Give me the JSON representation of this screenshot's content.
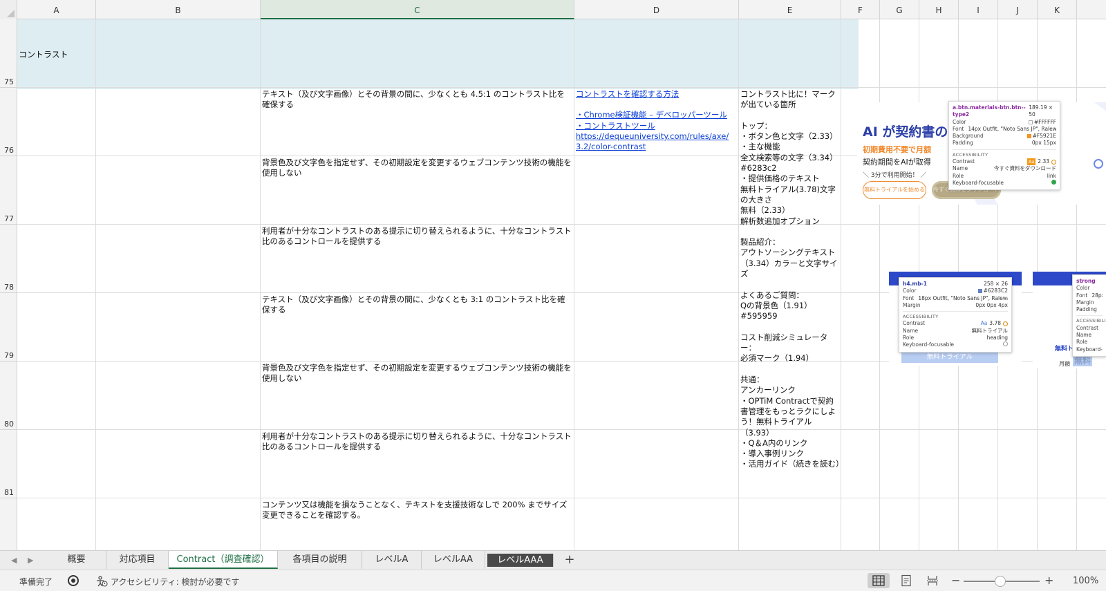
{
  "columns": [
    "A",
    "B",
    "C",
    "D",
    "E",
    "F",
    "G",
    "H",
    "I",
    "J",
    "K"
  ],
  "selected_column": "C",
  "rows": [
    "75",
    "76",
    "77",
    "78",
    "79",
    "80",
    "81"
  ],
  "section_title": "コントラスト",
  "c_cells": [
    "テキスト（及び文字画像）とその背景の間に、少なくとも 4.5:1 のコントラスト比を確保する",
    "背景色及び文字色を指定せず、その初期設定を変更するウェブコンテンツ技術の機能を使用しない",
    "利用者が十分なコントラストのある提示に切り替えられるように、十分なコントラスト比のあるコントロールを提供する",
    "テキスト（及び文字画像）とその背景の間に、少なくとも 3:1 のコントラスト比を確保する",
    "背景色及び文字色を指定せず、その初期設定を変更するウェブコンテンツ技術の機能を使用しない",
    "利用者が十分なコントラストのある提示に切り替えられるように、十分なコントラスト比のあるコントロールを提供する",
    "コンテンツ又は機能を損なうことなく、テキストを支援技術なしで 200% までサイズ変更できることを確認する。"
  ],
  "d_links": {
    "heading": "コントラストを確認する方法",
    "item1": "・Chrome検証機能 – デベロッパーツール",
    "item2": "・コントラストツール",
    "url": "https://dequeuniversity.com/rules/axe/3.2/color-contrast"
  },
  "e_text": "コントラスト比に！マークが出ている箇所\n\nトップ：\n・ボタン色と文字（2.33）\n・主な機能\n全文検索等の文字（3.34）\n#6283c2\n・提供価格のテキスト\n無料トライアル(3.78)文字の大きさ\n無料（2.33）\n解析数追加オプション\n\n製品紹介：\nアウトソーシングテキスト（3.34）カラーと文字サイズ\n\nよくあるご質問：\nQの背景色（1.91）\n#595959\n\nコスト削減シミュレーター：\n必須マーク（1.94）\n\n共通：\nアンカーリンク\n・OPTiM Contractで契約書管理をもっとラクにしよう！無料トライアル（3.93）\n・Q＆A内のリンク\n・導入事例リンク\n・活用ガイド（続きを読む）",
  "shot1": {
    "headline": "AI が契約書の",
    "orange": "初期費用不要で月額",
    "line3": "契約期間をAIが取得",
    "line4": "＼ 3分で利用開始！ ／",
    "btn_trial": "無料トライアルを始める",
    "btn_download": "今すぐ資料をダウンロード",
    "tip": {
      "selector": "a.btn.materials-btn.btn--type2",
      "size": "189.19 × 50",
      "color_label": "Color",
      "color_value": "#FFFFFF",
      "font_label": "Font",
      "font_value": "14px Outfit, \"Noto Sans JP\", Raleway, ...",
      "bg_label": "Background",
      "bg_value": "#F5921E",
      "padding_label": "Padding",
      "padding_value": "0px 15px",
      "section": "ACCESSIBILITY",
      "contrast_label": "Contrast",
      "contrast_badge": "Aa",
      "contrast_value": "2.33",
      "name_label": "Name",
      "name_value": "今すぐ資料をダウンロード",
      "role_label": "Role",
      "role_value": "link",
      "kf_label": "Keyboard-focusable",
      "colors": {
        "fg": "#FFFFFF",
        "bg": "#F5921E"
      }
    }
  },
  "shot2": {
    "heading_btn": "無料トライアル",
    "tip": {
      "selector": "h4.mb-1",
      "size": "258 × 26",
      "color_label": "Color",
      "color_value": "#6283C2",
      "font_label": "Font",
      "font_value": "18px Outfit, \"Noto Sans JP\", Raleway, ...",
      "margin_label": "Margin",
      "margin_value": "0px 0px 4px",
      "section": "ACCESSIBILITY",
      "contrast_label": "Contrast",
      "contrast_badge": "Aa",
      "contrast_value": "3.78",
      "name_label": "Name",
      "name_value": "無料トライアル",
      "role_label": "Role",
      "role_value": "heading",
      "kf_label": "Keyboard-focusable",
      "colors": {
        "fg": "#6283C2"
      }
    }
  },
  "shot3": {
    "text1": "無料ト",
    "monthly": "月額",
    "free": "無料",
    "tip": {
      "selector": "strong",
      "color_label": "Color",
      "font_label": "Font",
      "font_value": "28px O",
      "margin_label": "Margin",
      "padding_label": "Padding",
      "section": "ACCESSIBILITY",
      "contrast_label": "Contrast",
      "name_label": "Name",
      "role_label": "Role",
      "kf_label": "Keyboard-foc"
    }
  },
  "tabs": [
    "概要",
    "対応項目",
    "Contract（調査確認）",
    "各項目の説明",
    "レベルA",
    "レベルAA",
    "レベルAAA"
  ],
  "active_tab": "Contract（調査確認）",
  "add_tab": "+",
  "status": {
    "ready": "準備完了",
    "accessibility": "アクセシビリティ: 検討が必要です",
    "zoom": "100%",
    "zoom_minus": "−",
    "zoom_plus": "+"
  },
  "colors": {
    "accent": "#1E7145",
    "band": "#DEEDF2",
    "link": "#0B3FD6"
  }
}
